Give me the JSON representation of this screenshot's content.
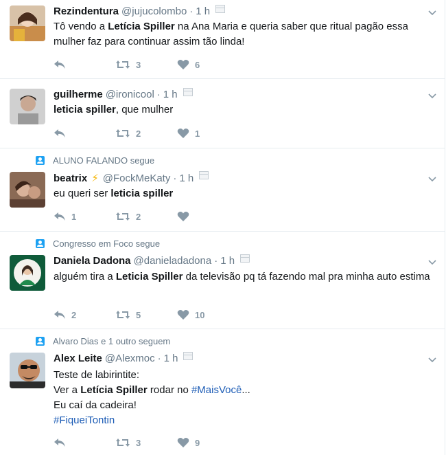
{
  "tweets": [
    {
      "context": "",
      "fullname": "Rezindentura",
      "username": "@jujucolombo",
      "time": "1 h",
      "text_parts": [
        {
          "t": "Tô vendo a ",
          "b": false
        },
        {
          "t": "Letícia Spiller",
          "b": true
        },
        {
          "t": " na Ana Maria e queria saber que ritual pagão essa mulher faz para continuar assim tão linda!",
          "b": false
        }
      ],
      "replies": "",
      "retweets": "3",
      "likes": "6"
    },
    {
      "context": "",
      "fullname": "guilherme",
      "username": "@ironicool",
      "time": "1 h",
      "text_parts": [
        {
          "t": "leticia spiller",
          "b": true
        },
        {
          "t": ", que mulher",
          "b": false
        }
      ],
      "replies": "",
      "retweets": "2",
      "likes": "1"
    },
    {
      "context": "ALUNO FALANDO segue",
      "fullname": "beatrix",
      "username": "@FockMeKaty",
      "time": "1 h",
      "text_parts": [
        {
          "t": "eu queri ser ",
          "b": false
        },
        {
          "t": "leticia spiller",
          "b": true
        }
      ],
      "replies": "1",
      "retweets": "2",
      "likes": ""
    },
    {
      "context": "Congresso em Foco segue",
      "fullname": "Daniela Dadona",
      "username": "@danieladadona",
      "time": "1 h",
      "text_parts": [
        {
          "t": "alguém tira a ",
          "b": false
        },
        {
          "t": "Leticia Spiller",
          "b": true
        },
        {
          "t": " da televisão pq tá fazendo mal pra minha auto estima",
          "b": false
        }
      ],
      "replies": "2",
      "retweets": "5",
      "likes": "10"
    },
    {
      "context": "Alvaro Dias e 1 outro seguem",
      "fullname": "Alex Leite",
      "username": "@Alexmoc",
      "time": "1 h",
      "text_lines": [
        [
          {
            "t": "Teste de labirintite:",
            "b": false
          }
        ],
        [
          {
            "t": "Ver a ",
            "b": false
          },
          {
            "t": "Letícia Spiller",
            "b": true
          },
          {
            "t": " rodar no ",
            "b": false
          },
          {
            "t": "#MaisVocê",
            "b": false,
            "h": true
          },
          {
            "t": "...",
            "b": false
          }
        ],
        [
          {
            "t": "Eu caí da cadeira!",
            "b": false
          }
        ],
        [
          {
            "t": "#FiqueiTontin",
            "b": false,
            "h": true
          }
        ]
      ],
      "replies": "",
      "retweets": "3",
      "likes": "9"
    }
  ],
  "colors": {
    "accent": "#1da1f2",
    "hashtag": "#1b5bb5",
    "muted": "#657786",
    "icon": "#8899a6"
  }
}
